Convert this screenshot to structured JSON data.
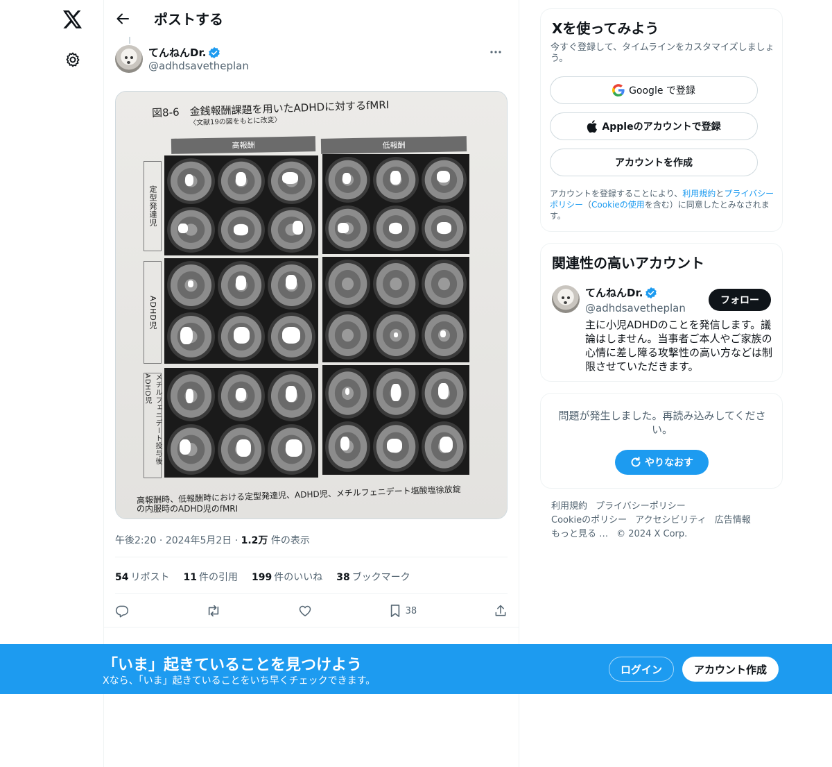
{
  "nav": {
    "logo_icon": "x-logo-icon",
    "settings_icon": "gear-icon"
  },
  "header": {
    "title": "ポストする"
  },
  "post": {
    "author_name": "てんねんDr.",
    "author_handle": "@adhdsavetheplan",
    "media": {
      "figure_title": "図8-6　金銭報酬課題を用いたADHDに対するfMRI",
      "figure_subtitle": "〈文献19の図をもとに改変〉",
      "column_headers": [
        "高報酬",
        "低報酬"
      ],
      "row_labels": [
        "定型発達児",
        "ADHD児",
        "メチルフェニデート投与後ADHD児"
      ],
      "caption_line1": "高報酬時、低報酬時における定型発達児、ADHD児、メチルフェニデート塩酸塩徐放錠",
      "caption_line2": "の内服時のADHD児のfMRI"
    },
    "time": "午後2:20",
    "date": "2024年5月2日",
    "views_count": "1.2万",
    "views_label": "件の表示",
    "stats": [
      {
        "count": "54",
        "label": "リポスト"
      },
      {
        "count": "11",
        "label": "件の引用"
      },
      {
        "count": "199",
        "label": "件のいいね"
      },
      {
        "count": "38",
        "label": "ブックマーク"
      }
    ],
    "bookmark_count": "38"
  },
  "signup": {
    "title": "Xを使ってみよう",
    "subtitle": "今すぐ登録して、タイムラインをカスタマイズしましょう。",
    "google_label": "Google で登録",
    "apple_label": "Appleのアカウントで登録",
    "create_label": "アカウントを作成",
    "legal_prefix": "アカウントを登録することにより、",
    "legal_terms": "利用規約",
    "legal_and": "と",
    "legal_privacy": "プライバシーポリシー",
    "legal_mid": "（",
    "legal_cookie": "Cookieの使用",
    "legal_suffix": "を含む）に同意したとみなされます。"
  },
  "relevant": {
    "title": "関連性の高いアカウント",
    "name": "てんねんDr.",
    "handle": "@adhdsavetheplan",
    "follow_label": "フォロー",
    "bio": "主に小児ADHDのことを発信します。議論はしません。当事者ご本人やご家族の心情に差し障る攻撃性の高い方などは制限させていただきます。"
  },
  "error": {
    "message": "問題が発生しました。再読み込みしてください。",
    "retry_label": "やりなおす"
  },
  "footer": {
    "links": [
      "利用規約",
      "プライバシーポリシー",
      "Cookieのポリシー",
      "アクセシビリティ",
      "広告情報",
      "もっと見る …"
    ],
    "copyright": "© 2024 X Corp."
  },
  "banner": {
    "title": "「いま」起きていることを見つけよう",
    "subtitle": "Xなら、「いま」起きていることをいち早くチェックできます。",
    "login_label": "ログイン",
    "create_label": "アカウント作成"
  },
  "colors": {
    "accent": "#1d9bf0",
    "text": "#0f1419",
    "muted": "#536471"
  }
}
